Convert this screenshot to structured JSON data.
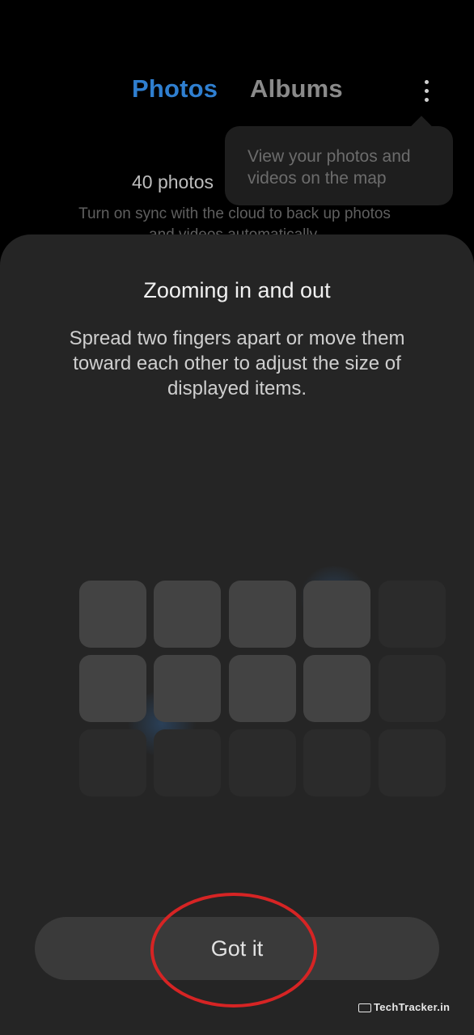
{
  "header": {
    "tabs": [
      {
        "label": "Photos",
        "active": true
      },
      {
        "label": "Albums",
        "active": false
      }
    ],
    "more_icon": "more-vertical-icon"
  },
  "tooltip": {
    "text": "View your photos and videos on the map"
  },
  "library": {
    "count": "40 photos",
    "sync_message": "Turn on sync with the cloud to back up photos and videos automatically."
  },
  "sheet": {
    "title": "Zooming in and out",
    "description": "Spread two fingers apart or move them toward each other to adjust the size of displayed items.",
    "button_label": "Got it"
  },
  "watermark": {
    "text": "TechTracker.in"
  },
  "colors": {
    "accent": "#2f7fd0",
    "highlight_circle": "#d62424",
    "sheet_bg": "#252525"
  }
}
